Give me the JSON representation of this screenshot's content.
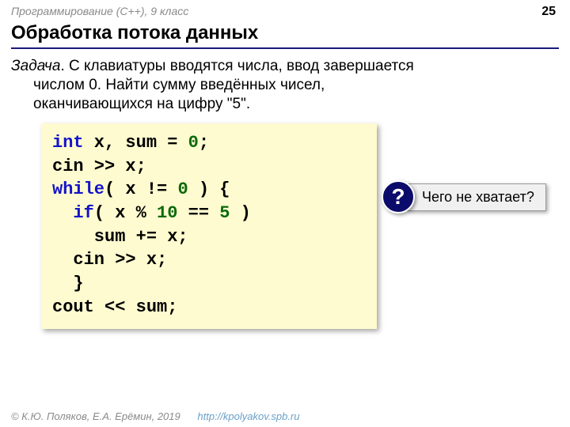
{
  "header": {
    "course": "Программирование (C++), 9 класс",
    "page": "25"
  },
  "title": "Обработка потока данных",
  "task": {
    "label": "Задача",
    "line1": ". С клавиатуры вводятся числа, ввод завершается",
    "line2": "числом 0. Найти сумму введённых чисел,",
    "line3": "оканчивающихся на цифру \"5\"."
  },
  "code": {
    "l1_kw": "int",
    "l1_rest": " x, sum = ",
    "l1_zero": "0",
    "l1_semi": ";",
    "l2": "cin >> x;",
    "l3_kw": "while",
    "l3_open": "( x != ",
    "l3_zero": "0",
    "l3_close": " ) {",
    "l4_indent": "  ",
    "l4_kw": "if",
    "l4_open": "( x % ",
    "l4_ten": "10",
    "l4_eq": " == ",
    "l4_five": "5",
    "l4_close": " )",
    "l5": "    sum += x;",
    "l6": "  cin >> x;",
    "l7": "  }",
    "l8": "cout << sum;"
  },
  "callout": {
    "mark": "?",
    "text": "Чего не хватает?"
  },
  "footer": {
    "copyright": "© К.Ю. Поляков, Е.А. Ерёмин, 2019",
    "url": "http://kpolyakov.spb.ru"
  }
}
